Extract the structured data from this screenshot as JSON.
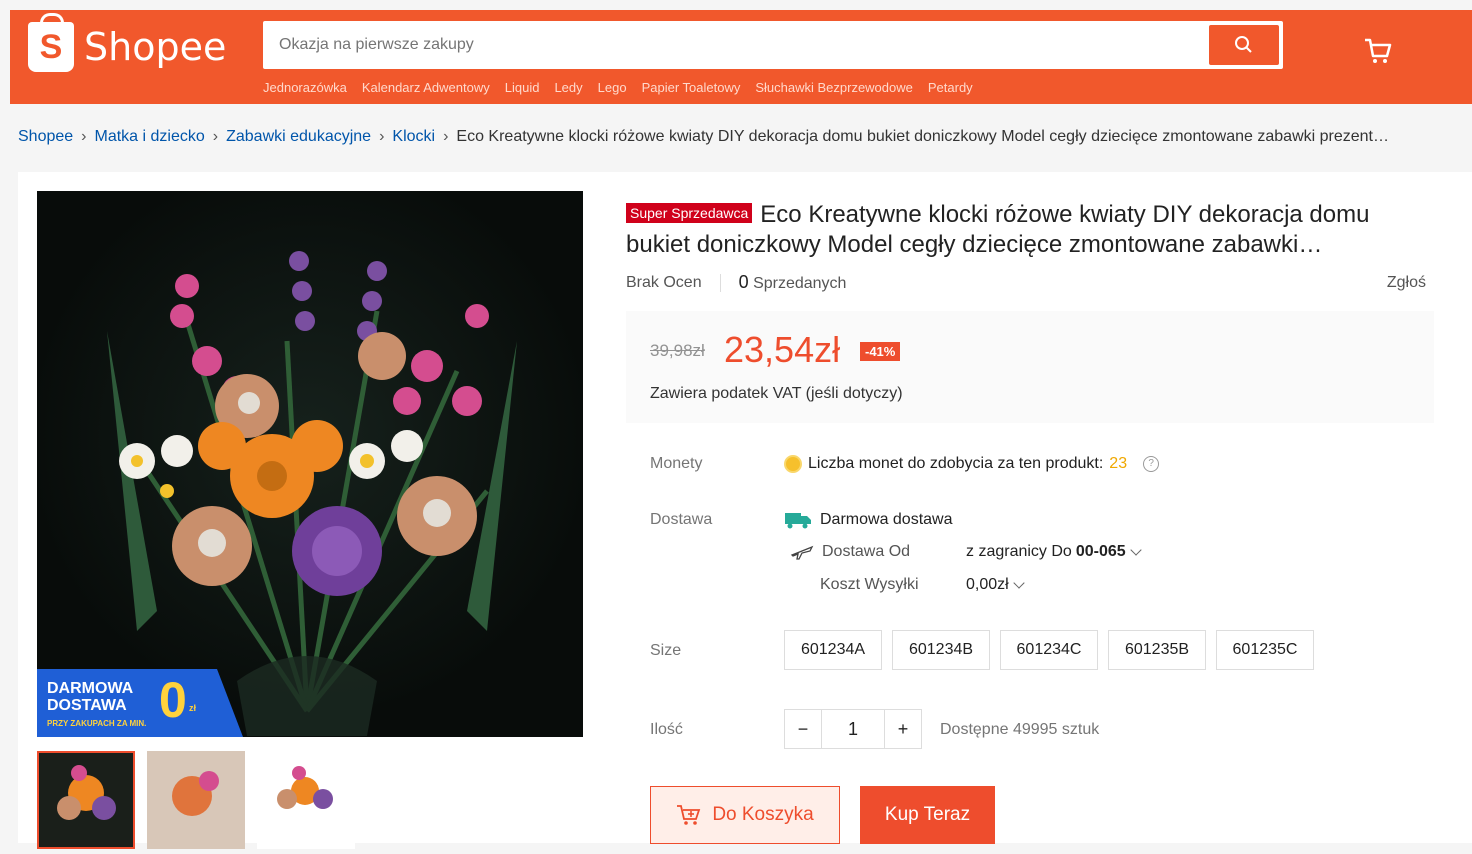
{
  "header": {
    "logo_text": "Shopee",
    "logo_letter": "S",
    "search_placeholder": "Okazja na pierwsze zakupy",
    "hotwords": [
      "Jednorazówka",
      "Kalendarz Adwentowy",
      "Liquid",
      "Ledy",
      "Lego",
      "Papier Toaletowy",
      "Słuchawki Bezprzewodowe",
      "Petardy"
    ],
    "brand_color": "#f1582c"
  },
  "breadcrumb": {
    "items": [
      "Shopee",
      "Matka i dziecko",
      "Zabawki edukacyjne",
      "Klocki"
    ],
    "current": "Eco Kreatywne klocki różowe kwiaty DIY dekoracja domu bukiet doniczkowy Model cegły dziecięce zmontowane zabawki prezent…"
  },
  "product": {
    "badge": "Super Sprzedawca",
    "title": "Eco Kreatywne klocki różowe kwiaty DIY dekoracja domu bukiet doniczkowy Model cegły dziecięce zmontowane zabawki…",
    "rating_text": "Brak Ocen",
    "sold_count": "0",
    "sold_label": "Sprzedanych",
    "report": "Zgłoś",
    "old_price": "39,98zł",
    "price": "23,54zł",
    "discount": "-41%",
    "vat_note": "Zawiera podatek VAT (jeśli dotyczy)",
    "image_banner_line1": "DARMOWA",
    "image_banner_line2": "DOSTAWA",
    "image_banner_small": "PRZY ZAKUPACH ZA MIN.",
    "image_banner_zero": "0",
    "image_banner_currency": "zł"
  },
  "coins": {
    "label": "Monety",
    "text": "Liczba monet do zdobycia za ten produkt:",
    "value": "23"
  },
  "shipping": {
    "label": "Dostawa",
    "free": "Darmowa dostawa",
    "from_label": "Dostawa Od",
    "from_value": "z zagranicy Do ",
    "postal_code": "00-065",
    "cost_label": "Koszt Wysyłki",
    "cost_value": "0,00zł"
  },
  "size": {
    "label": "Size",
    "options": [
      "601234A",
      "601234B",
      "601234C",
      "601235B",
      "601235C"
    ]
  },
  "quantity": {
    "label": "Ilość",
    "minus": "−",
    "value": "1",
    "plus": "+",
    "available": "Dostępne 49995 sztuk"
  },
  "actions": {
    "add_to_cart": "Do Koszyka",
    "buy_now": "Kup Teraz"
  }
}
